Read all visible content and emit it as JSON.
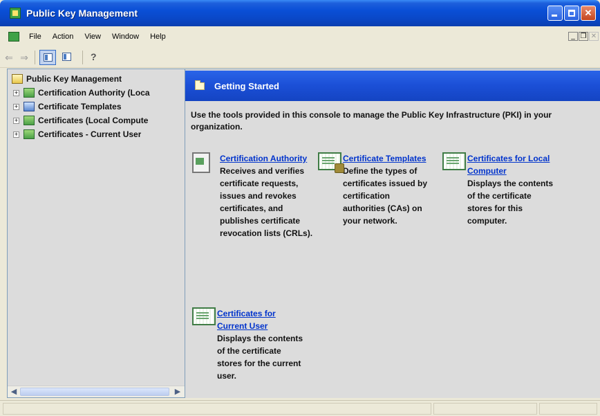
{
  "window": {
    "title": "Public Key Management"
  },
  "menubar": {
    "items": [
      "File",
      "Action",
      "View",
      "Window",
      "Help"
    ],
    "mdi_minimize": "_",
    "mdi_restore": "❐",
    "mdi_close": "✕"
  },
  "toolbar": {
    "back": "⇐",
    "forward": "⇒",
    "help": "?"
  },
  "tree": {
    "root": "Public Key Management",
    "items": [
      "Certification Authority (Loca",
      "Certificate Templates",
      "Certificates (Local Compute",
      "Certificates - Current User"
    ],
    "expander": "+"
  },
  "content": {
    "heading": "Getting Started",
    "intro": "Use the tools provided in this console to manage the Public Key Infrastructure (PKI) in your organization.",
    "items": [
      {
        "link": "Certification Authority",
        "description": "Receives and verifies certificate requests, issues and revokes certificates, and publishes certificate revocation lists (CRLs)."
      },
      {
        "link": "Certificate Templates",
        "description": "Define the types of certificates issued by certification authorities (CAs) on your network."
      },
      {
        "link": "Certificates for Local Computer",
        "description": "Displays the contents of the certificate stores for this computer."
      },
      {
        "link": "Certificates for Current User",
        "description": "Displays the contents of the certificate stores for the current user."
      }
    ]
  }
}
